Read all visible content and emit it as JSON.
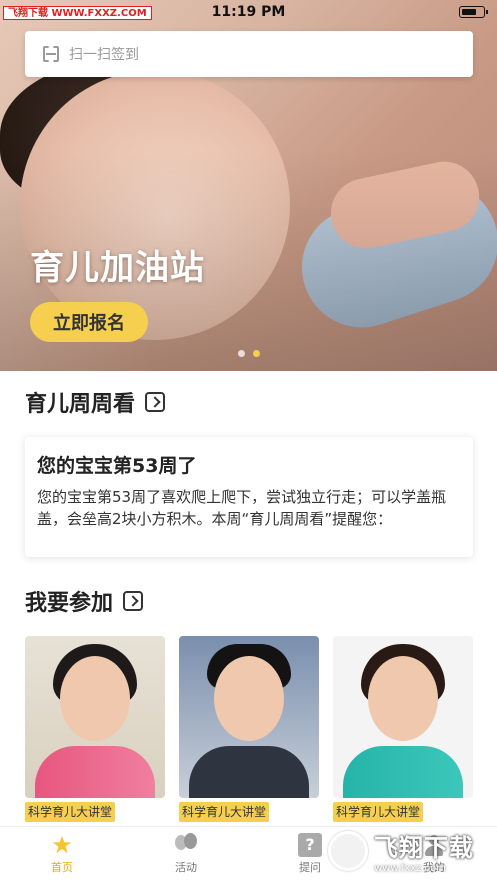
{
  "status_bar": {
    "carrier": "飞翔下载 WWW.FXXZ.COM",
    "time": "11:19 PM",
    "battery_level": 0.7
  },
  "search": {
    "placeholder": "扫一扫签到",
    "icon": "scan-icon"
  },
  "hero": {
    "title": "育儿加油站",
    "button_label": "立即报名",
    "slide_count": 2,
    "active_slide": 1
  },
  "weekly": {
    "section_title": "育儿周周看",
    "card_title": "您的宝宝第53周了",
    "card_body": "您的宝宝第53周了喜欢爬上爬下，尝试独立行走；可以学盖瓶盖，会垒高2块小方积木。本周“育儿周周看”提醒您："
  },
  "join": {
    "section_title": "我要参加",
    "items": [
      {
        "tag": "科学育儿大讲堂"
      },
      {
        "tag": "科学育儿大讲堂"
      },
      {
        "tag": "科学育儿大讲堂"
      }
    ]
  },
  "tabbar": {
    "items": [
      {
        "label": "首页",
        "icon": "star-icon",
        "active": true
      },
      {
        "label": "活动",
        "icon": "balloon-icon",
        "active": false
      },
      {
        "label": "提问",
        "icon": "question-icon",
        "active": false
      },
      {
        "label": "我的",
        "icon": "person-icon",
        "active": false
      }
    ]
  },
  "watermark": {
    "main": "飞翔下载",
    "sub": "www.fxxz.com"
  },
  "colors": {
    "accent": "#f6cf4f",
    "active_tab": "#e8a90c"
  }
}
